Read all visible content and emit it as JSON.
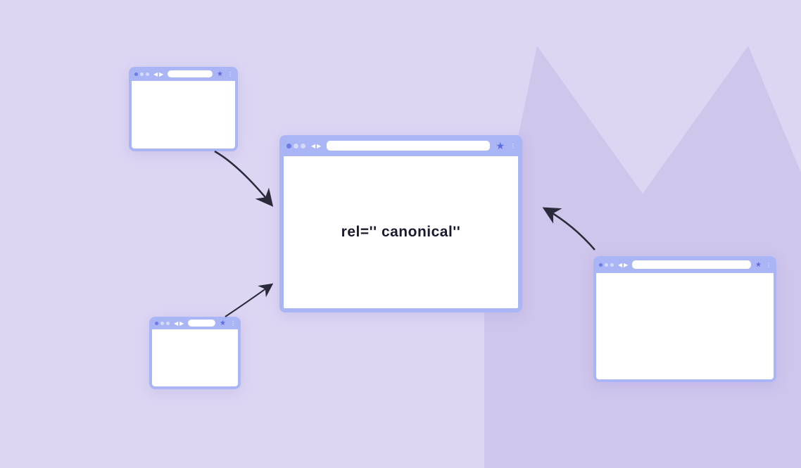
{
  "diagram": {
    "main_window": {
      "content_text": "rel='' canonical''"
    },
    "small_windows": [
      {
        "position": "top-left"
      },
      {
        "position": "bottom-left"
      },
      {
        "position": "right"
      }
    ],
    "arrows_count": 3
  }
}
